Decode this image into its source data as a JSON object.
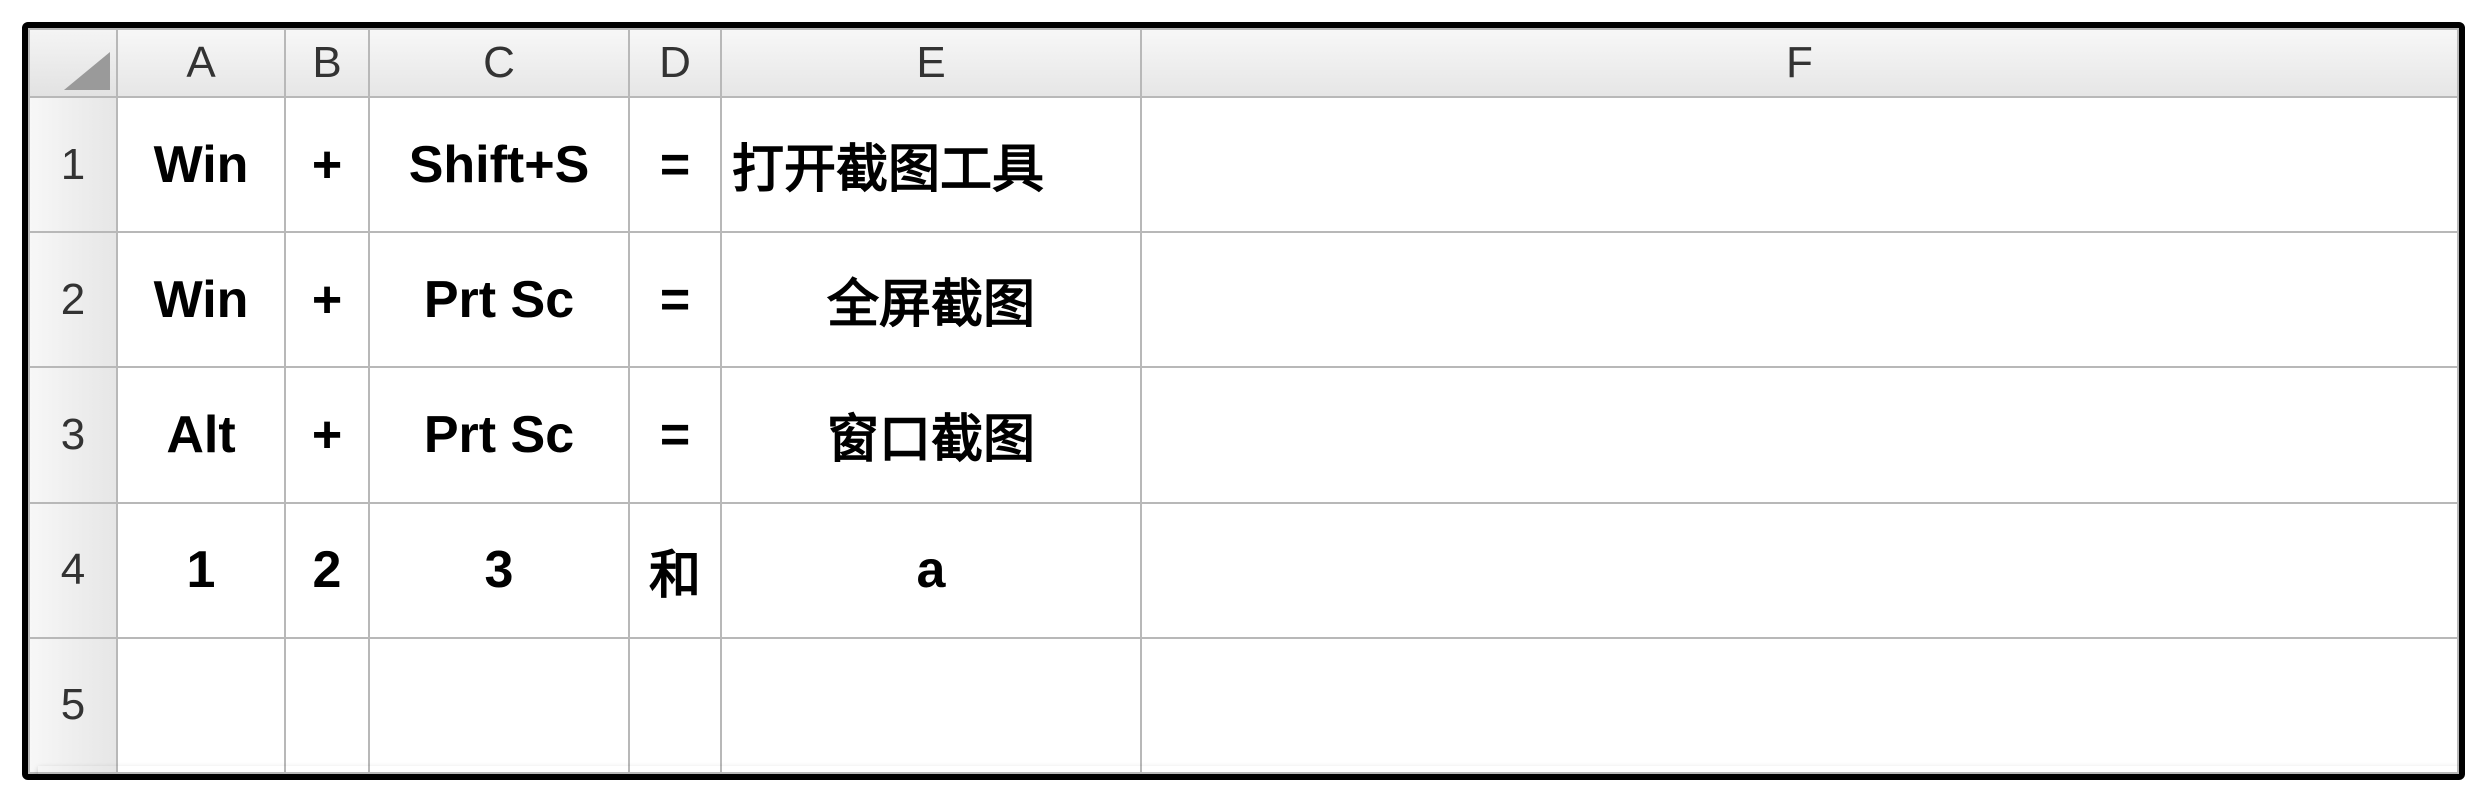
{
  "columns": {
    "A": "A",
    "B": "B",
    "C": "C",
    "D": "D",
    "E": "E",
    "F": "F"
  },
  "row_headers": {
    "1": "1",
    "2": "2",
    "3": "3",
    "4": "4",
    "5": "5"
  },
  "cells": {
    "r1": {
      "A": "Win",
      "B": "+",
      "C": "Shift+S",
      "D": "=",
      "E": "打开截图工具",
      "F": ""
    },
    "r2": {
      "A": "Win",
      "B": "+",
      "C": "Prt Sc",
      "D": "=",
      "E": "全屏截图",
      "F": ""
    },
    "r3": {
      "A": "Alt",
      "B": "+",
      "C": "Prt Sc",
      "D": "=",
      "E": "窗口截图",
      "F": ""
    },
    "r4": {
      "A": "1",
      "B": "2",
      "C": "3",
      "D": "和",
      "E": "a",
      "F": ""
    },
    "r5": {
      "A": "",
      "B": "",
      "C": "",
      "D": "",
      "E": "",
      "F": ""
    }
  }
}
